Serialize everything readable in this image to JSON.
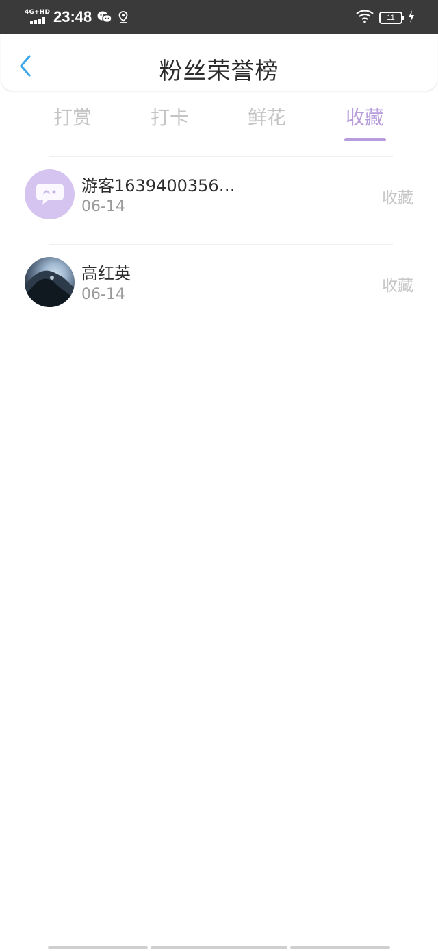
{
  "status_bar": {
    "network": "4G+HD",
    "time": "23:48",
    "battery": "11"
  },
  "header": {
    "title": "粉丝荣誉榜"
  },
  "tabs": [
    {
      "label": "打赏",
      "active": false
    },
    {
      "label": "打卡",
      "active": false
    },
    {
      "label": "鲜花",
      "active": false
    },
    {
      "label": "收藏",
      "active": true
    }
  ],
  "list": [
    {
      "name": "游客1639400356…",
      "date": "06-14",
      "action": "收藏",
      "avatar": "guest-chat-avatar"
    },
    {
      "name": "高红英",
      "date": "06-14",
      "action": "收藏",
      "avatar": "photo-avatar"
    }
  ],
  "colors": {
    "accent": "#b79ddc",
    "back_arrow": "#3fa8e6",
    "status_bar_bg": "#3a3a3a",
    "tab_inactive": "#c4c4c4"
  }
}
